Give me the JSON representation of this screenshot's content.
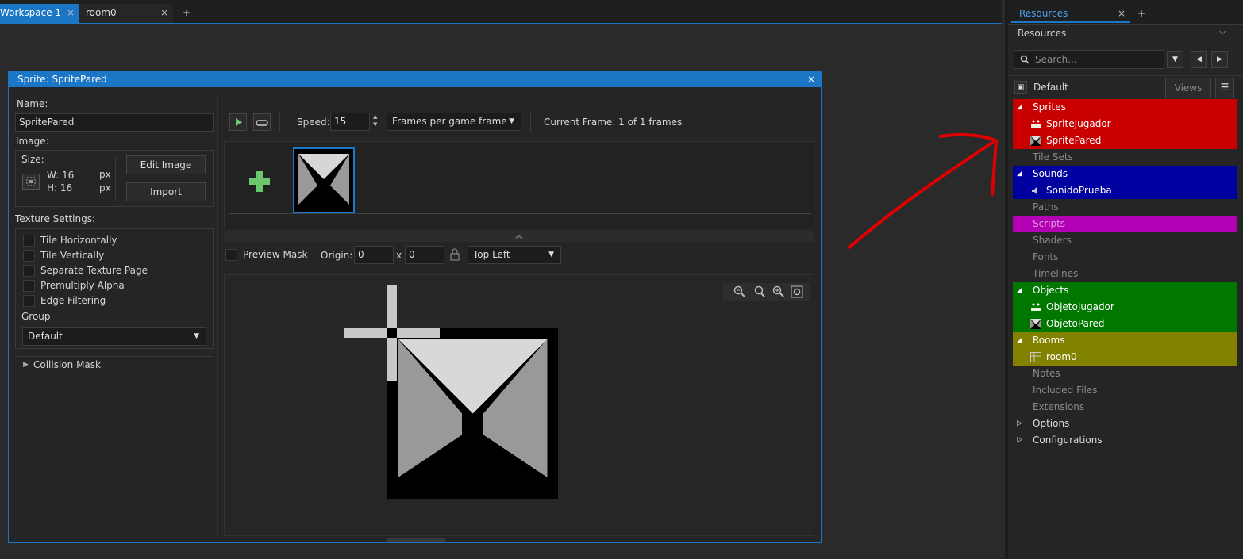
{
  "tabs": [
    {
      "label": "Workspace 1",
      "close": "×"
    },
    {
      "label": "room0",
      "close": "×"
    },
    {
      "label": "+"
    }
  ],
  "sprite_window": {
    "title": "Sprite: SpritePared",
    "close": "×",
    "name_label": "Name:",
    "name_value": "SpritePared",
    "image_label": "Image:",
    "size_label": "Size:",
    "width": "W: 16",
    "height": "H: 16",
    "unit": "px",
    "edit_image": "Edit Image",
    "import": "Import",
    "texture_settings_label": "Texture Settings:",
    "texture_options": [
      "Tile Horizontally",
      "Tile Vertically",
      "Separate Texture Page",
      "Premultiply Alpha",
      "Edge Filtering"
    ],
    "group_label": "Group",
    "group_value": "Default",
    "collision_mask": "Collision Mask",
    "speed_label": "Speed:",
    "speed_value": "15",
    "speed_mode": "Frames per game frame",
    "current_frame": "Current Frame: 1 of 1 frames",
    "preview_mask": "Preview Mask",
    "origin_label": "Origin:",
    "origin_x": "0",
    "origin_sep": "x",
    "origin_y": "0",
    "origin_preset": "Top Left"
  },
  "resources": {
    "tab_label": "Resources",
    "tab_close": "×",
    "tab_add": "+",
    "header": "Resources",
    "search_placeholder": "Search...",
    "view_name": "Default",
    "views_button": "Views",
    "tree": [
      {
        "label": "Sprites",
        "expanded": true,
        "color": "#c80000",
        "children": [
          "SpriteJugador",
          "SpritePared"
        ]
      },
      {
        "label": "Tile Sets"
      },
      {
        "label": "Sounds",
        "expanded": true,
        "color": "#0000a0",
        "children": [
          "SonidoPrueba"
        ]
      },
      {
        "label": "Paths"
      },
      {
        "label": "Scripts",
        "color": "#b400b4"
      },
      {
        "label": "Shaders"
      },
      {
        "label": "Fonts"
      },
      {
        "label": "Timelines"
      },
      {
        "label": "Objects",
        "expanded": true,
        "color": "#007800",
        "children": [
          "ObjetoJugador",
          "ObjetoPared"
        ]
      },
      {
        "label": "Rooms",
        "expanded": true,
        "color": "#828200",
        "children": [
          "room0"
        ]
      },
      {
        "label": "Notes"
      },
      {
        "label": "Included Files"
      },
      {
        "label": "Extensions"
      },
      {
        "label": "Options"
      },
      {
        "label": "Configurations"
      }
    ]
  },
  "colors": {
    "accent": "#1b76c6",
    "annotation_arrow": "#e00000"
  }
}
